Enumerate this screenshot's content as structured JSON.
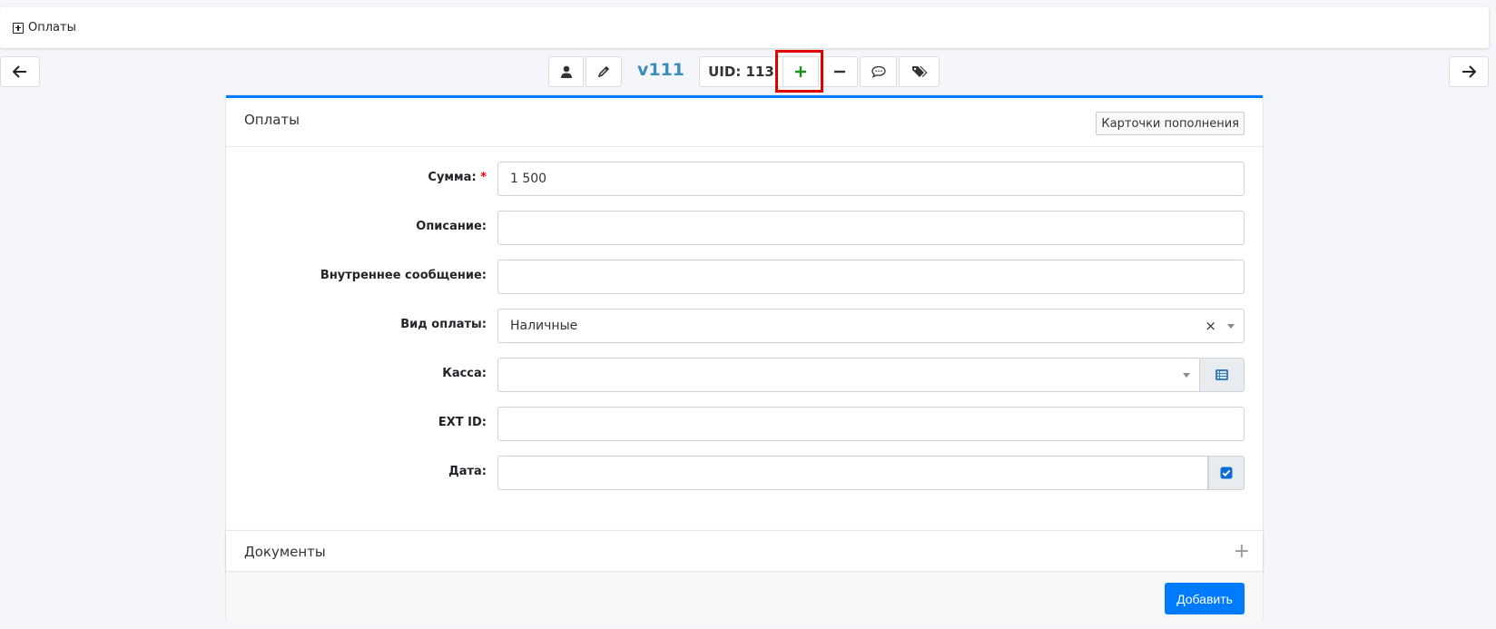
{
  "topbar": {
    "label": "Оплаты",
    "icon": "plus-square-icon"
  },
  "nav": {
    "back_icon": "arrow-left-icon",
    "forward_icon": "arrow-right-icon"
  },
  "user": {
    "login": "v111",
    "uid_label": "UID: 113"
  },
  "toolbar": {
    "icons": [
      "user-icon",
      "pencil-icon",
      "plus-icon",
      "minus-icon",
      "comment-icon",
      "tags-icon"
    ]
  },
  "card": {
    "title": "Оплаты",
    "header_button": "Карточки пополнения",
    "accent_color": "#007bff"
  },
  "form": {
    "sum": {
      "label": "Сумма:",
      "required_mark": "*",
      "value": "1 500"
    },
    "description": {
      "label": "Описание:",
      "value": ""
    },
    "internal_message": {
      "label": "Внутреннее сообщение:",
      "value": ""
    },
    "payment_type": {
      "label": "Вид оплаты:",
      "value": "Наличные",
      "clear": "×"
    },
    "cashbox": {
      "label": "Касса:",
      "value": ""
    },
    "ext_id": {
      "label": "EXT ID:",
      "value": ""
    },
    "date": {
      "label": "Дата:",
      "value": "",
      "checkbox_checked": true
    }
  },
  "documents": {
    "title": "Документы",
    "expand": "+"
  },
  "submit": {
    "label": "Добавить"
  }
}
